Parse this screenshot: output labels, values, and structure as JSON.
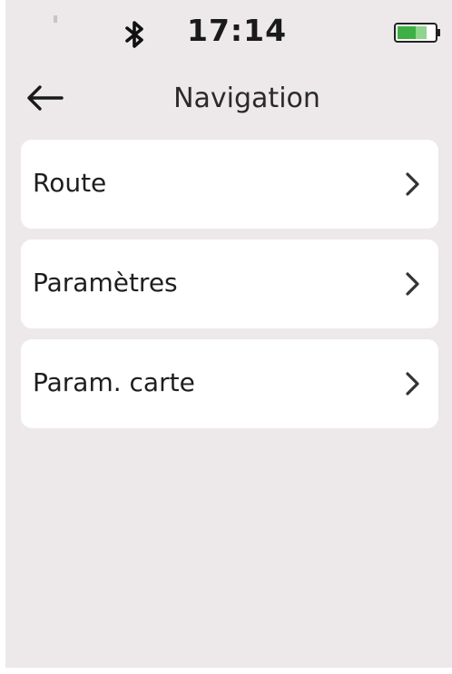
{
  "status_bar": {
    "time": "17:14",
    "icons": [
      "signal-icon",
      "bluetooth-icon",
      "battery-icon"
    ],
    "battery_color": "#3cb043"
  },
  "header": {
    "title": "Navigation",
    "back_icon": "back-arrow-icon"
  },
  "menu": {
    "items": [
      {
        "label": "Route"
      },
      {
        "label": "Paramètres"
      },
      {
        "label": "Param. carte"
      }
    ],
    "chevron_icon": "chevron-right-icon"
  },
  "colors": {
    "screen_background": "#ede9ea",
    "card_background": "#ffffff",
    "text": "#1e1e1e"
  }
}
